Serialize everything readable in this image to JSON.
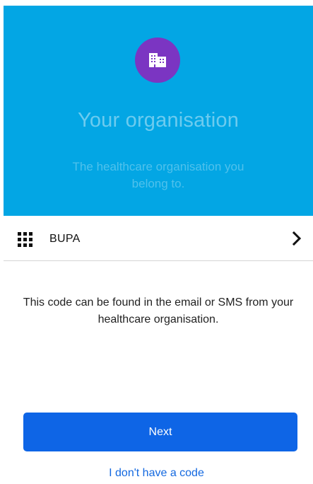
{
  "hero": {
    "title": "Your organisation",
    "subtitle": "The healthcare organisation you belong to.",
    "icon": "building-icon",
    "background_color": "#03a6e4",
    "icon_circle_color": "#7b35c2"
  },
  "organisation": {
    "icon": "grid-icon",
    "name": "BUPA",
    "action_icon": "chevron-right-icon"
  },
  "info": {
    "text": "This code can be found in the email or SMS from your healthcare organisation."
  },
  "actions": {
    "next_label": "Next",
    "next_color": "#0e65e6",
    "no_code_label": "I don't have a code",
    "link_color": "#1469e0"
  }
}
